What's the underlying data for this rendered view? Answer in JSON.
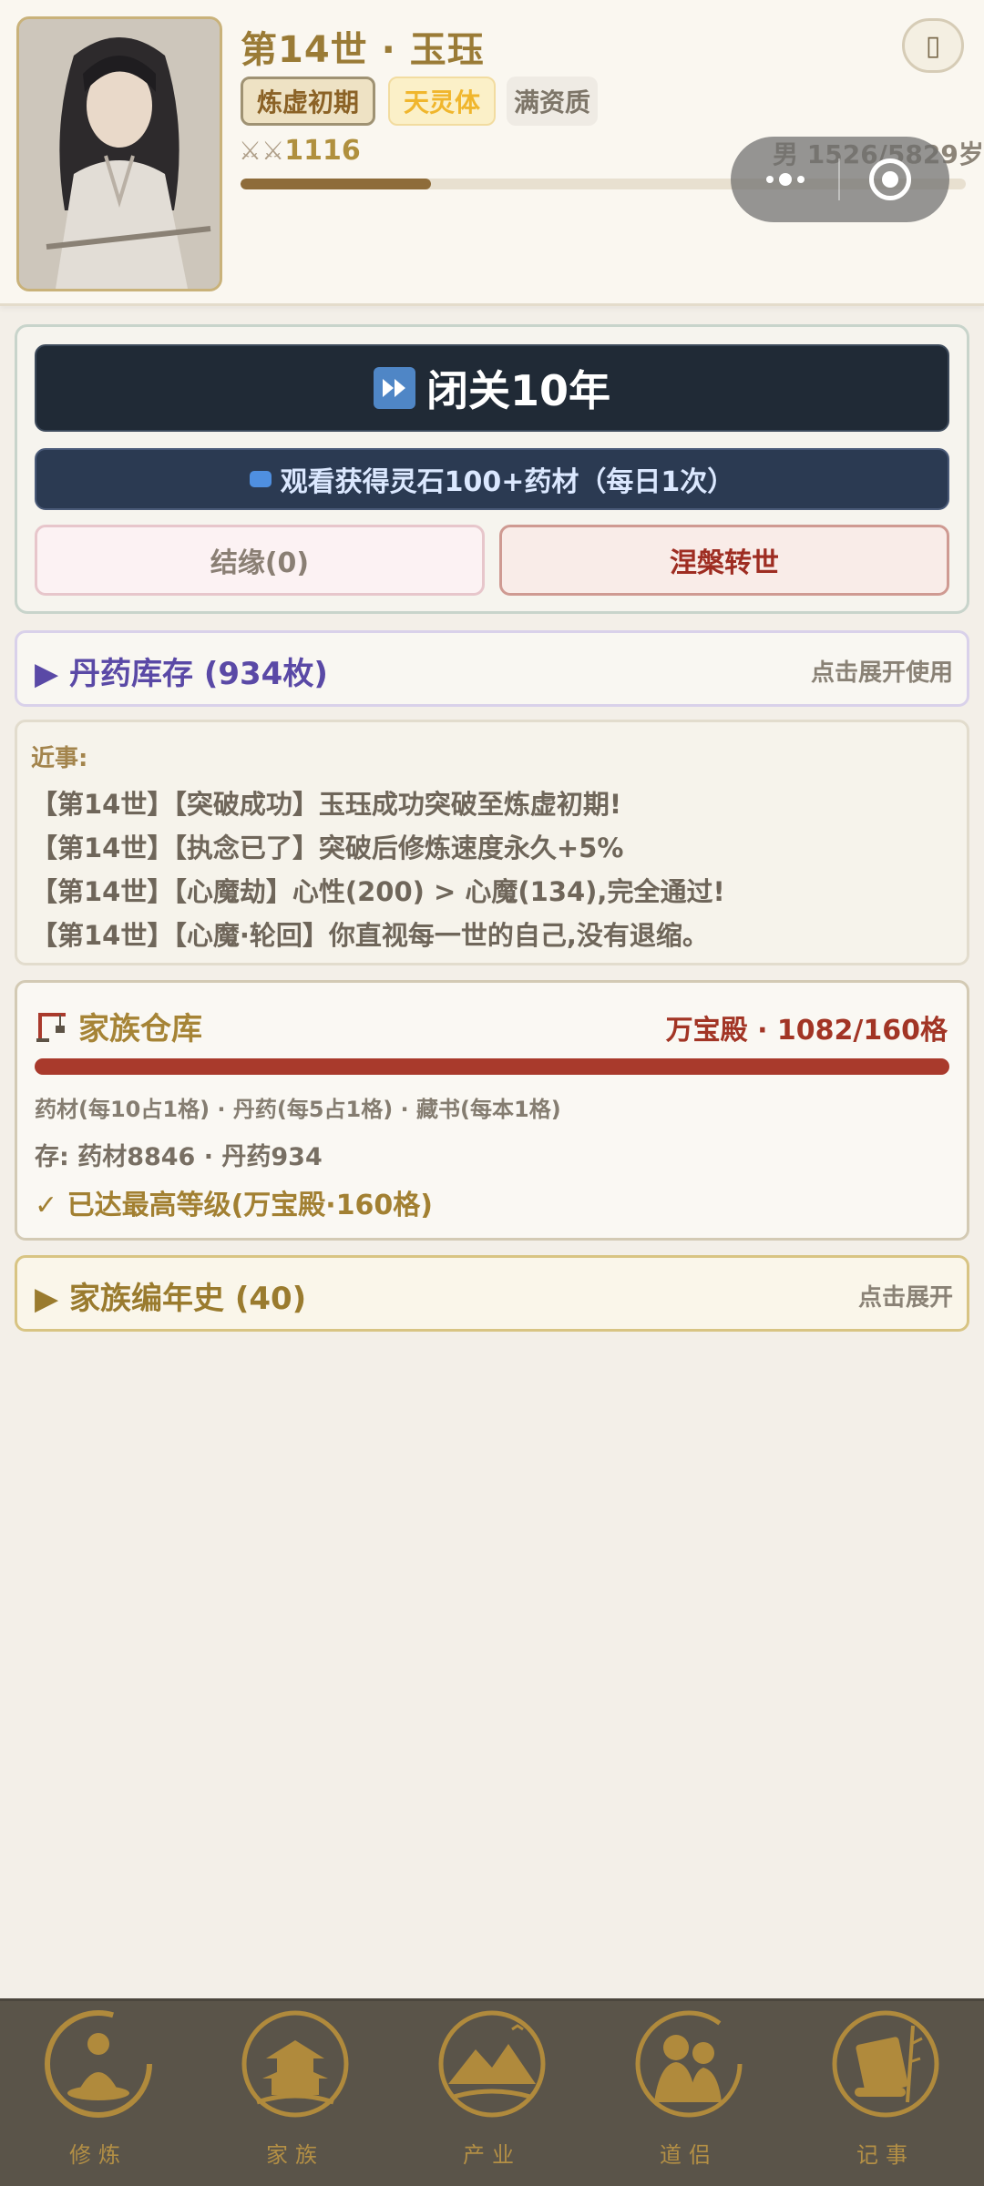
{
  "header": {
    "title": "第14世 · 玉珏",
    "tags": {
      "realm": "炼虚初期",
      "body": "天灵体",
      "aptitude": "满资质"
    },
    "power": "1116",
    "gender_age": "男 1526/5829岁",
    "lifespan_progress": 0.263
  },
  "actions": {
    "retreat_label": "闭关10年",
    "ad_label": "观看获得灵石100+药材（每日1次）",
    "bond_label": "结缘(0)",
    "rebirth_label": "涅槃转世"
  },
  "pills": {
    "title": "▶ 丹药库存 (934枚)",
    "hint": "点击展开使用"
  },
  "recent": {
    "label": "近事:",
    "lines": [
      "【第14世】【突破成功】玉珏成功突破至炼虚初期!",
      "【第14世】【执念已了】突破后修炼速度永久+5%",
      "【第14世】【心魔劫】心性(200) > 心魔(134),完全通过!",
      "【第14世】【心魔·轮回】你直视每一世的自己,没有退缩。"
    ]
  },
  "warehouse": {
    "title": "家族仓库",
    "level": "万宝殿 · 1082/160格",
    "rules": "药材(每10占1格) · 丹药(每5占1格) · 藏书(每本1格)",
    "stock": "存: 药材8846 · 丹药934",
    "max_note": "✓ 已达最高等级(万宝殿·160格)"
  },
  "chronicle": {
    "title": "▶ 家族编年史 (40)",
    "hint": "点击展开"
  },
  "nav": [
    {
      "label": "修炼",
      "icon": "meditation-icon"
    },
    {
      "label": "家族",
      "icon": "pagoda-icon"
    },
    {
      "label": "产业",
      "icon": "mountain-icon"
    },
    {
      "label": "道侣",
      "icon": "couple-icon"
    },
    {
      "label": "记事",
      "icon": "scroll-icon"
    }
  ],
  "colors": {
    "accent_gold": "#a68436",
    "danger_red": "#a93a2c",
    "dark_button": "#202a36",
    "nav_bg": "#5a5449"
  }
}
